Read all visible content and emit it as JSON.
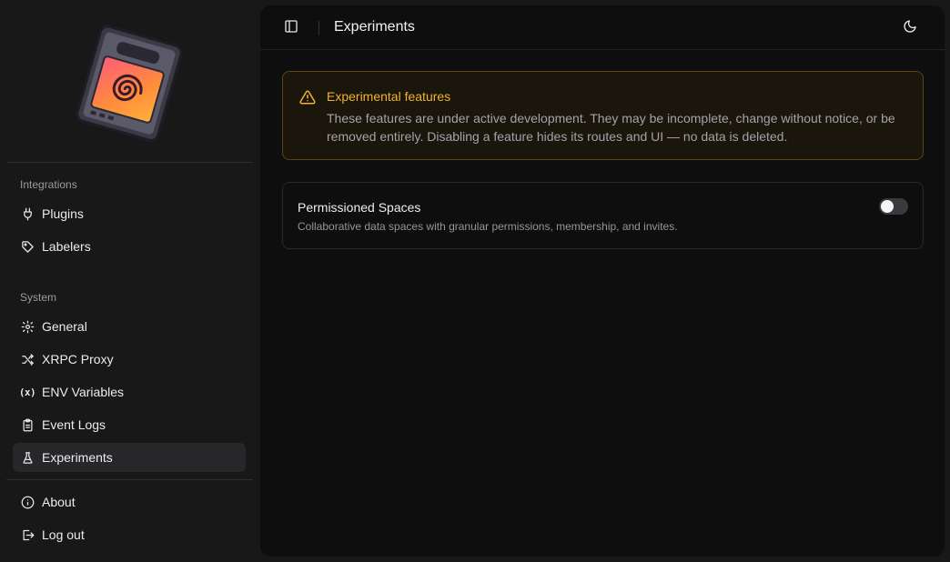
{
  "sidebar": {
    "groups": [
      {
        "label": "Integrations",
        "items": [
          {
            "label": "Plugins",
            "icon": "plug-icon"
          },
          {
            "label": "Labelers",
            "icon": "tag-icon"
          }
        ]
      },
      {
        "label": "System",
        "items": [
          {
            "label": "General",
            "icon": "gear-icon"
          },
          {
            "label": "XRPC Proxy",
            "icon": "shuffle-icon"
          },
          {
            "label": "ENV Variables",
            "icon": "variable-icon"
          },
          {
            "label": "Event Logs",
            "icon": "clipboard-icon"
          },
          {
            "label": "Experiments",
            "icon": "flask-icon",
            "active": true
          }
        ]
      }
    ],
    "footer": [
      {
        "label": "About",
        "icon": "info-icon"
      },
      {
        "label": "Log out",
        "icon": "logout-icon"
      }
    ],
    "env_glyph": "(x)"
  },
  "header": {
    "title": "Experiments"
  },
  "alert": {
    "title": "Experimental features",
    "body": "These features are under active development. They may be incomplete, change without notice, or be removed entirely. Disabling a feature hides its routes and UI — no data is deleted.",
    "color": "#f0b429"
  },
  "features": [
    {
      "title": "Permissioned Spaces",
      "description": "Collaborative data spaces with granular permissions, membership, and invites.",
      "enabled": false
    }
  ],
  "colors": {
    "sidebar_bg": "#181818",
    "main_bg": "#0e0e0f",
    "active_item_bg": "#27272a",
    "warning": "#f0b429"
  }
}
